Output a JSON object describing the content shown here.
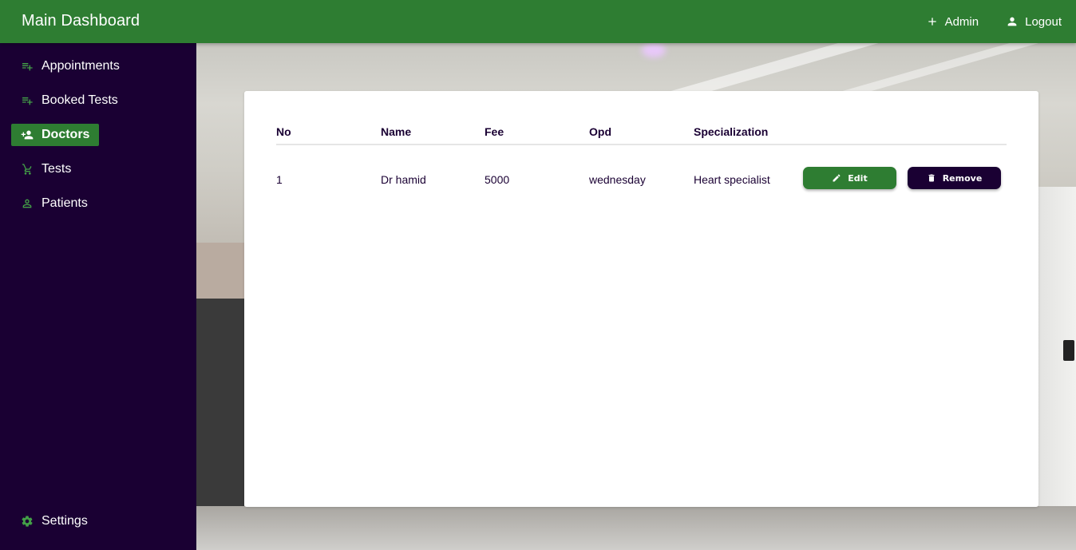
{
  "header": {
    "title": "Main Dashboard",
    "actions": [
      {
        "label": "Admin",
        "icon": "plus-icon"
      },
      {
        "label": "Logout",
        "icon": "person-icon"
      }
    ],
    "color": "#2e7d32"
  },
  "sidebar": {
    "background": "#1a0033",
    "items": [
      {
        "label": "Appointments",
        "icon": "playlist-add-icon",
        "active": false
      },
      {
        "label": "Booked Tests",
        "icon": "playlist-add-icon",
        "active": false
      },
      {
        "label": "Doctors",
        "icon": "person-add-icon",
        "active": true
      },
      {
        "label": "Tests",
        "icon": "cart-plus-icon",
        "active": false
      },
      {
        "label": "Patients",
        "icon": "person-outline-icon",
        "active": false
      }
    ],
    "settings": {
      "label": "Settings",
      "icon": "gear-icon"
    }
  },
  "doctors_table": {
    "columns": [
      "No",
      "Name",
      "Fee",
      "Opd",
      "Specialization"
    ],
    "rows": [
      {
        "no": "1",
        "name": "Dr hamid",
        "fee": "5000",
        "opd": "wednesday",
        "specialization": "Heart specialist"
      }
    ],
    "actions": {
      "edit_label": "Edit",
      "remove_label": "Remove"
    }
  },
  "colors": {
    "accent": "#2e7d32",
    "brand_dark": "#1a0033",
    "icon_green": "#43a047"
  }
}
